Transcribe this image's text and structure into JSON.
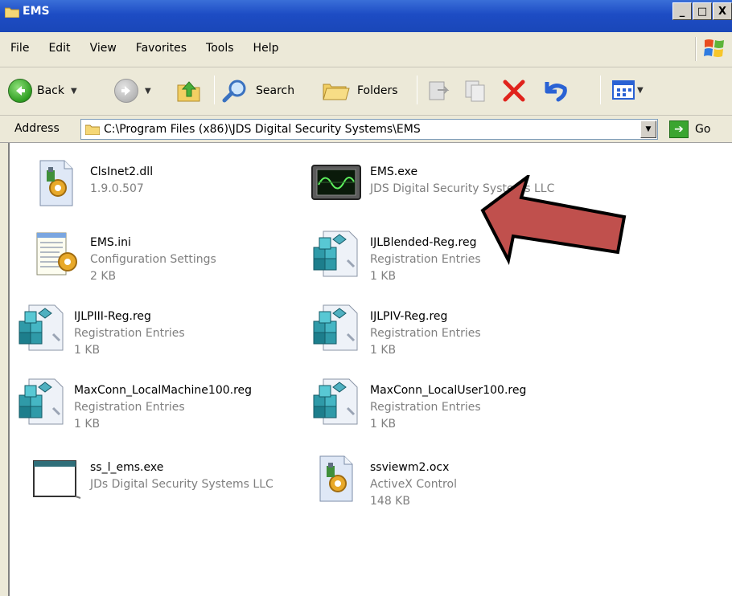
{
  "window": {
    "title": "EMS",
    "buttons": {
      "minimize": "_",
      "maximize": "□",
      "close": "X"
    }
  },
  "menu": [
    {
      "label": "File"
    },
    {
      "label": "Edit"
    },
    {
      "label": "View"
    },
    {
      "label": "Favorites"
    },
    {
      "label": "Tools"
    },
    {
      "label": "Help"
    }
  ],
  "toolbar": {
    "back_label": "Back",
    "search_label": "Search",
    "folders_label": "Folders"
  },
  "address": {
    "label": "Address",
    "path": "C:\\Program Files (x86)\\JDS Digital Security Systems\\EMS",
    "go_label": "Go"
  },
  "files": [
    {
      "name": "ClsInet2.dll",
      "line2": "1.9.0.507",
      "line3": "",
      "icon": "dll-icon"
    },
    {
      "name": "EMS.exe",
      "line2": "JDS Digital Security Systems LLC",
      "line3": "",
      "icon": "ems-exe-icon"
    },
    {
      "name": "EMS.ini",
      "line2": "Configuration Settings",
      "line3": "2 KB",
      "icon": "ini-icon"
    },
    {
      "name": "IJLBlended-Reg.reg",
      "line2": "Registration Entries",
      "line3": "1 KB",
      "icon": "reg-icon"
    },
    {
      "name": "IJLPIII-Reg.reg",
      "line2": "Registration Entries",
      "line3": "1 KB",
      "icon": "reg-icon"
    },
    {
      "name": "IJLPIV-Reg.reg",
      "line2": "Registration Entries",
      "line3": "1 KB",
      "icon": "reg-icon"
    },
    {
      "name": "MaxConn_LocalMachine100.reg",
      "line2": "Registration Entries",
      "line3": "1 KB",
      "icon": "reg-icon"
    },
    {
      "name": "MaxConn_LocalUser100.reg",
      "line2": "Registration Entries",
      "line3": "1 KB",
      "icon": "reg-icon"
    },
    {
      "name": "ss_l_ems.exe",
      "line2": "JDs Digital Security Systems LLC",
      "line3": "",
      "icon": "exe-window-icon"
    },
    {
      "name": "ssviewm2.ocx",
      "line2": "ActiveX Control",
      "line3": "148 KB",
      "icon": "ocx-icon"
    }
  ],
  "colors": {
    "titlebar": "#1d4cc4",
    "chrome": "#ece9d8",
    "annotation_arrow": "#c0504d"
  }
}
